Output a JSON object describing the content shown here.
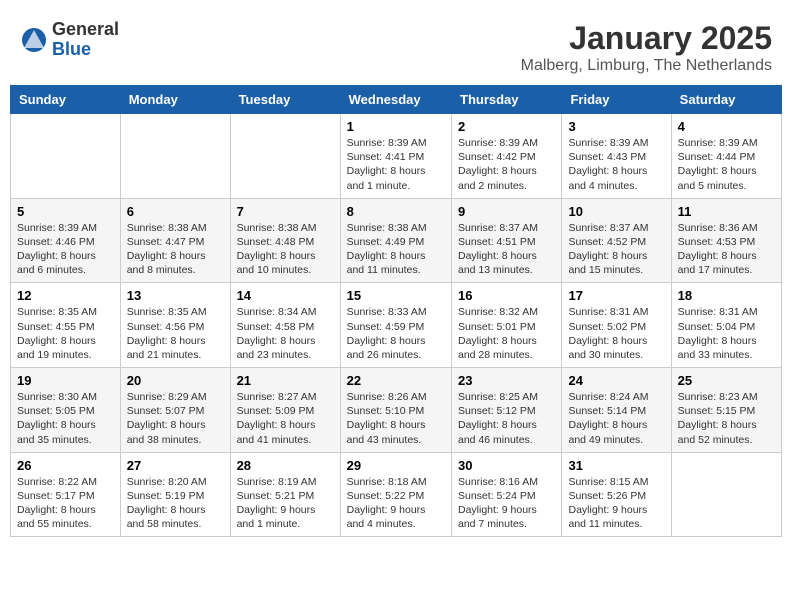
{
  "logo": {
    "general": "General",
    "blue": "Blue"
  },
  "title": "January 2025",
  "location": "Malberg, Limburg, The Netherlands",
  "days_of_week": [
    "Sunday",
    "Monday",
    "Tuesday",
    "Wednesday",
    "Thursday",
    "Friday",
    "Saturday"
  ],
  "weeks": [
    [
      {
        "day": "",
        "info": ""
      },
      {
        "day": "",
        "info": ""
      },
      {
        "day": "",
        "info": ""
      },
      {
        "day": "1",
        "info": "Sunrise: 8:39 AM\nSunset: 4:41 PM\nDaylight: 8 hours and 1 minute."
      },
      {
        "day": "2",
        "info": "Sunrise: 8:39 AM\nSunset: 4:42 PM\nDaylight: 8 hours and 2 minutes."
      },
      {
        "day": "3",
        "info": "Sunrise: 8:39 AM\nSunset: 4:43 PM\nDaylight: 8 hours and 4 minutes."
      },
      {
        "day": "4",
        "info": "Sunrise: 8:39 AM\nSunset: 4:44 PM\nDaylight: 8 hours and 5 minutes."
      }
    ],
    [
      {
        "day": "5",
        "info": "Sunrise: 8:39 AM\nSunset: 4:46 PM\nDaylight: 8 hours and 6 minutes."
      },
      {
        "day": "6",
        "info": "Sunrise: 8:38 AM\nSunset: 4:47 PM\nDaylight: 8 hours and 8 minutes."
      },
      {
        "day": "7",
        "info": "Sunrise: 8:38 AM\nSunset: 4:48 PM\nDaylight: 8 hours and 10 minutes."
      },
      {
        "day": "8",
        "info": "Sunrise: 8:38 AM\nSunset: 4:49 PM\nDaylight: 8 hours and 11 minutes."
      },
      {
        "day": "9",
        "info": "Sunrise: 8:37 AM\nSunset: 4:51 PM\nDaylight: 8 hours and 13 minutes."
      },
      {
        "day": "10",
        "info": "Sunrise: 8:37 AM\nSunset: 4:52 PM\nDaylight: 8 hours and 15 minutes."
      },
      {
        "day": "11",
        "info": "Sunrise: 8:36 AM\nSunset: 4:53 PM\nDaylight: 8 hours and 17 minutes."
      }
    ],
    [
      {
        "day": "12",
        "info": "Sunrise: 8:35 AM\nSunset: 4:55 PM\nDaylight: 8 hours and 19 minutes."
      },
      {
        "day": "13",
        "info": "Sunrise: 8:35 AM\nSunset: 4:56 PM\nDaylight: 8 hours and 21 minutes."
      },
      {
        "day": "14",
        "info": "Sunrise: 8:34 AM\nSunset: 4:58 PM\nDaylight: 8 hours and 23 minutes."
      },
      {
        "day": "15",
        "info": "Sunrise: 8:33 AM\nSunset: 4:59 PM\nDaylight: 8 hours and 26 minutes."
      },
      {
        "day": "16",
        "info": "Sunrise: 8:32 AM\nSunset: 5:01 PM\nDaylight: 8 hours and 28 minutes."
      },
      {
        "day": "17",
        "info": "Sunrise: 8:31 AM\nSunset: 5:02 PM\nDaylight: 8 hours and 30 minutes."
      },
      {
        "day": "18",
        "info": "Sunrise: 8:31 AM\nSunset: 5:04 PM\nDaylight: 8 hours and 33 minutes."
      }
    ],
    [
      {
        "day": "19",
        "info": "Sunrise: 8:30 AM\nSunset: 5:05 PM\nDaylight: 8 hours and 35 minutes."
      },
      {
        "day": "20",
        "info": "Sunrise: 8:29 AM\nSunset: 5:07 PM\nDaylight: 8 hours and 38 minutes."
      },
      {
        "day": "21",
        "info": "Sunrise: 8:27 AM\nSunset: 5:09 PM\nDaylight: 8 hours and 41 minutes."
      },
      {
        "day": "22",
        "info": "Sunrise: 8:26 AM\nSunset: 5:10 PM\nDaylight: 8 hours and 43 minutes."
      },
      {
        "day": "23",
        "info": "Sunrise: 8:25 AM\nSunset: 5:12 PM\nDaylight: 8 hours and 46 minutes."
      },
      {
        "day": "24",
        "info": "Sunrise: 8:24 AM\nSunset: 5:14 PM\nDaylight: 8 hours and 49 minutes."
      },
      {
        "day": "25",
        "info": "Sunrise: 8:23 AM\nSunset: 5:15 PM\nDaylight: 8 hours and 52 minutes."
      }
    ],
    [
      {
        "day": "26",
        "info": "Sunrise: 8:22 AM\nSunset: 5:17 PM\nDaylight: 8 hours and 55 minutes."
      },
      {
        "day": "27",
        "info": "Sunrise: 8:20 AM\nSunset: 5:19 PM\nDaylight: 8 hours and 58 minutes."
      },
      {
        "day": "28",
        "info": "Sunrise: 8:19 AM\nSunset: 5:21 PM\nDaylight: 9 hours and 1 minute."
      },
      {
        "day": "29",
        "info": "Sunrise: 8:18 AM\nSunset: 5:22 PM\nDaylight: 9 hours and 4 minutes."
      },
      {
        "day": "30",
        "info": "Sunrise: 8:16 AM\nSunset: 5:24 PM\nDaylight: 9 hours and 7 minutes."
      },
      {
        "day": "31",
        "info": "Sunrise: 8:15 AM\nSunset: 5:26 PM\nDaylight: 9 hours and 11 minutes."
      },
      {
        "day": "",
        "info": ""
      }
    ]
  ]
}
